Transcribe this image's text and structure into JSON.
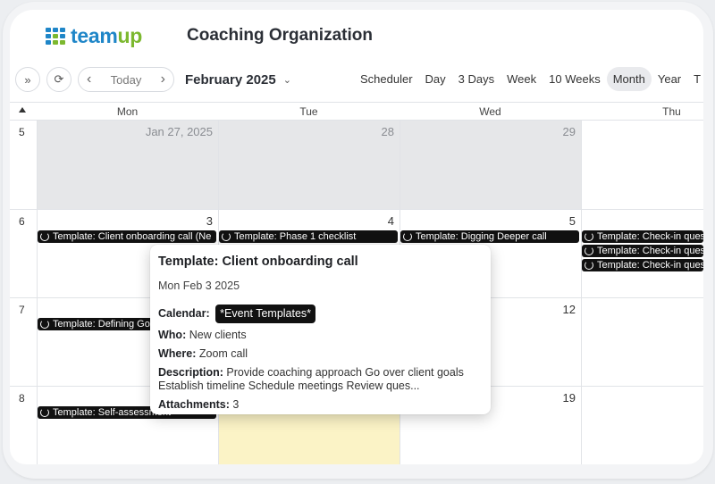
{
  "header": {
    "logo": {
      "part1": "team",
      "part2": "up",
      "colors": [
        "#1f86c8",
        "#1f86c8",
        "#1f86c8",
        "#1f86c8",
        "#7cb82f",
        "#1f86c8",
        "#1f86c8",
        "#7cb82f",
        "#7cb82f"
      ]
    },
    "org_title": "Coaching Organization"
  },
  "toolbar": {
    "expand_icon": "»",
    "refresh_icon": "⟳",
    "prev_icon": "‹",
    "today_label": "Today",
    "next_icon": "›",
    "month_label": "February 2025",
    "views": [
      "Scheduler",
      "Day",
      "3 Days",
      "Week",
      "10 Weeks",
      "Month",
      "Year",
      "T"
    ],
    "active_view": "Month"
  },
  "calendar": {
    "dow": [
      "Mon",
      "Tue",
      "Wed",
      "Thu"
    ],
    "weeks": [
      {
        "num": "5",
        "days": [
          "Jan 27, 2025",
          "28",
          "29",
          ""
        ]
      },
      {
        "num": "6",
        "days": [
          "3",
          "4",
          "5",
          ""
        ]
      },
      {
        "num": "7",
        "days": [
          "",
          "",
          "12",
          ""
        ]
      },
      {
        "num": "8",
        "days": [
          "",
          "",
          "19",
          ""
        ]
      }
    ],
    "events": {
      "w6_mon": "Template: Client onboarding call (Ne",
      "w6_tue": "Template: Phase 1 checklist",
      "w6_wed": "Template: Digging Deeper call",
      "w6_thu_1": "Template: Check-in ques",
      "w6_thu_2": "Template: Check-in ques",
      "w6_thu_3": "Template: Check-in ques",
      "w7_mon": "Template: Defining Go",
      "w8_mon": "Template: Self-assessment"
    }
  },
  "popover": {
    "title": "Template: Client onboarding call",
    "date": "Mon Feb 3 2025",
    "calendar_label": "Calendar:",
    "calendar_value": "*Event Templates*",
    "who_label": "Who:",
    "who_value": "New clients",
    "where_label": "Where:",
    "where_value": "Zoom call",
    "description_label": "Description:",
    "description_value": "Provide coaching approach  Go over client goals Establish timeline Schedule meetings Review ques...",
    "attachments_label": "Attachments:",
    "attachments_value": "3"
  }
}
